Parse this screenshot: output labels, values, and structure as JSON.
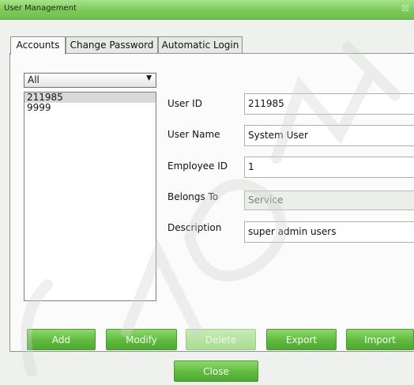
{
  "window": {
    "title": "User Management",
    "close_glyph": "☒"
  },
  "tabs": [
    {
      "label": "Accounts",
      "active": true
    },
    {
      "label": "Change Password",
      "active": false
    },
    {
      "label": "Automatic Login",
      "active": false
    }
  ],
  "filter": {
    "selected": "All",
    "arrow": "▼"
  },
  "accounts": [
    "211985",
    "9999"
  ],
  "form": {
    "user_id": {
      "label": "User ID",
      "value": "211985"
    },
    "user_name": {
      "label": "User Name",
      "value": "System User"
    },
    "employee_id": {
      "label": "Employee ID",
      "value": "1"
    },
    "belongs_to": {
      "label": "Belongs To",
      "value": "Service"
    },
    "description": {
      "label": "Description",
      "value": "super admin users"
    }
  },
  "buttons": {
    "add": "Add",
    "modify": "Modify",
    "delete": "Delete",
    "export": "Export",
    "import": "Import",
    "close": "Close"
  },
  "colors": {
    "accent": "#5fba3f",
    "titlebar": "#7cc95a",
    "disabled_button": "#a9dc90"
  }
}
